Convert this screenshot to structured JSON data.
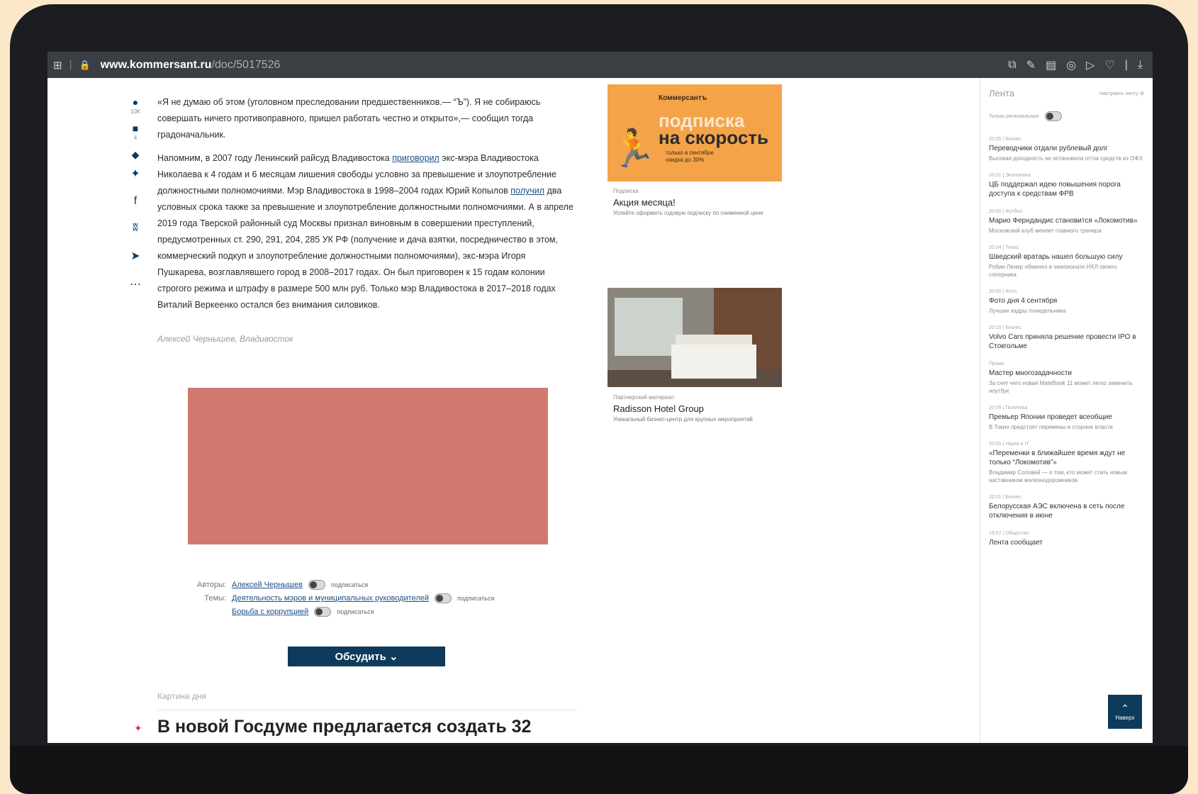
{
  "browser": {
    "url_domain": "www.kommersant.ru",
    "url_path": "/doc/5017526"
  },
  "share": {
    "views": "10K",
    "comments": "4"
  },
  "article": {
    "p1": "«Я не думаю об этом (уголовном преследовании предшественников.— “Ъ”). Я не собираюсь совершать ничего противоправного, пришел работать честно и открыто»,— сообщил тогда градоначальник.",
    "p2_a": "Напомним, в 2007 году Ленинский райсуд Владивостока ",
    "p2_link1": "приговорил",
    "p2_b": " экс-мэра Владивостока Николаева к 4 годам и 6 месяцам лишения свободы условно за превышение и злоупотребление должностными полномочиями. Мэр Владивостока в 1998–2004 годах Юрий Копылов ",
    "p2_link2": "получил",
    "p2_c": " два условных срока также за превышение и злоупотребление должностными полномочиями. А в апреле 2019 года Тверской районный суд Москвы признал виновным в совершении преступлений, предусмотренных ст. 290, 291, 204, 285 УК РФ (получение и дача взятки, посредничество в этом, коммерческий подкуп и злоупотребление должностными полномочиями), экс-мэра Игоря Пушкарева, возглавлявшего город в 2008–2017 годах. Он был приговорен к 15 годам колонии строгого режима и штрафу в размере 500 млн руб. Только мэр Владивостока в 2017–2018 годах Виталий Веркеенко остался без внимания силовиков.",
    "byline": "Алексей Чернышев, Владивосток"
  },
  "meta": {
    "authors_label": "Авторы:",
    "author": "Алексей Чернышев",
    "subscribe": "подписаться",
    "topics_label": "Темы:",
    "topic1": "Деятельность мэров и муниципальных руководителей",
    "topic2": "Борьба с коррупцией"
  },
  "discuss_label": "Обсудить",
  "picture_of_day": "Картина дня",
  "headline": "В новой Госдуме предлагается создать 32",
  "promo": {
    "brand": "Коммерсантъ",
    "line1": "подписка",
    "line2": "на скорость",
    "small1": "только в сентябре",
    "small2": "скидка до 30%",
    "kicker": "Подписка",
    "title": "Акция месяца!",
    "desc": "Успейте оформить годовую подписку по сниженной цене"
  },
  "hotel_ad": {
    "kicker": "Партнерский материал",
    "title": "Radisson Hotel Group",
    "desc": "Уникальный бизнес-центр для крупных мероприятий"
  },
  "feed": {
    "title": "Лента",
    "right": "Настроить ленту",
    "filter": "Только региональные",
    "items": [
      {
        "time": "20:05 | Бизнес",
        "title": "Переводчики отдали рублевый долг",
        "desc": "Высокая доходность не остановила отток средств из ОФЗ"
      },
      {
        "time": "20:01 | Экономика",
        "title": "ЦБ поддержал идею повышения порога доступа к средствам ФРВ",
        "desc": ""
      },
      {
        "time": "20:00 | Футбол",
        "title": "Марио Ферндандис становится «Локомотив»",
        "desc": "Московский клуб меняет главного тренера"
      },
      {
        "time": "20:04 | Тенис",
        "title": "Шведский вратарь нашел большую силу",
        "desc": "Робин Ленер обменял в чемпионате НХЛ своего соперника"
      },
      {
        "time": "20:00 | Фото",
        "title": "Фото дня 4 сентября",
        "desc": "Лучшие кадры понедельника"
      },
      {
        "time": "20:15 | Бизнес",
        "title": "Volvo Cars приняла решение провести IPO в Стокгольме",
        "desc": ""
      },
      {
        "time": "Промо",
        "title": "Мастер многозадачности",
        "desc": "За счет чего новая MateBook 11 может легко заменить ноутбук"
      },
      {
        "time": "20:09 | Политика",
        "title": "Премьер Японии проведет всеобщие",
        "desc": "В Токио предстоят перемены в стороне власти"
      },
      {
        "time": "20:05 | Наука и IT",
        "title": "«Переменки в ближайшее время ждут не только “Локомотив”»",
        "desc": "Владимир Соловей — о том, кто может стать новым наставником железнодорожников"
      },
      {
        "time": "20:01 | Бизнес",
        "title": "Белорусская АЭС включена в сеть после отключения в июне",
        "desc": ""
      },
      {
        "time": "19:57 | Общество",
        "title": "Лента сообщает",
        "desc": ""
      }
    ],
    "up_label": "Наверх"
  }
}
